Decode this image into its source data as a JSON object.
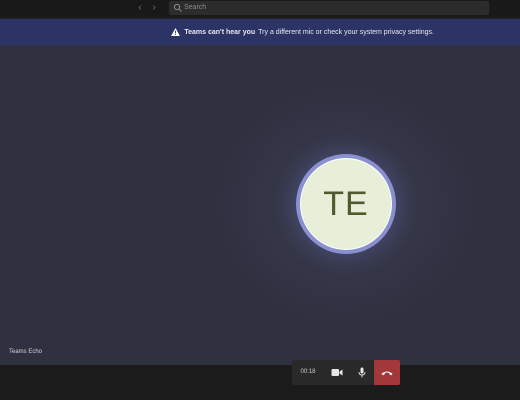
{
  "search": {
    "placeholder": "Search"
  },
  "banner": {
    "title": "Teams can't hear you",
    "message": "Try a different mic or check your system privacy settings."
  },
  "participant": {
    "initials": "TE",
    "name": "Teams Echo"
  },
  "call_controls": {
    "timer": "00:18"
  },
  "colors": {
    "banner_bg": "#2b3464",
    "avatar_bg": "#e8efd9",
    "avatar_text": "#4f5b2e",
    "avatar_ring": "#8a8fd0",
    "hangup_bg": "#a4373a"
  },
  "icons": [
    "chevron-left-icon",
    "chevron-right-icon",
    "search-icon",
    "warning-icon",
    "video-camera-icon",
    "microphone-icon",
    "hang-up-icon"
  ]
}
